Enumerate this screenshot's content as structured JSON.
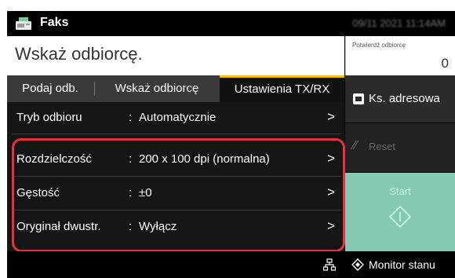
{
  "header": {
    "title": "Faks",
    "datetime": "09/11 2021 11:14AM"
  },
  "prompt": {
    "text": "Wskaż odbiorcę."
  },
  "confirm": {
    "label": "Potwierdź odbiorcę",
    "count": "0"
  },
  "tabs": [
    {
      "label": "Podaj odb."
    },
    {
      "label": "Wskaż odbiorcę"
    },
    {
      "label": "Ustawienia TX/RX",
      "active": true
    }
  ],
  "settings": [
    {
      "name": "Tryb odbioru",
      "sep": ":",
      "value": "Automatycznie",
      "arrow": ">"
    },
    {
      "name": "Rozdzielczość",
      "sep": ":",
      "value": "200 x 100 dpi (normalna)",
      "arrow": ">"
    },
    {
      "name": "Gęstość",
      "sep": ":",
      "value": "±0",
      "arrow": ">"
    },
    {
      "name": "Oryginał dwustr.",
      "sep": ":",
      "value": "Wyłącz",
      "arrow": ">"
    }
  ],
  "side": {
    "address_book": "Ks. adresowa",
    "reset": "Reset",
    "start": "Start"
  },
  "footer": {
    "monitor": "Monitor stanu"
  },
  "colors": {
    "accent_tab": "#f0c000",
    "highlight": "#e83239",
    "start": "#86c9b3"
  }
}
